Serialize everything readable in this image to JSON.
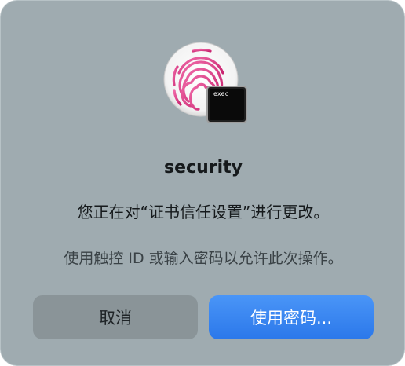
{
  "dialog": {
    "app_icon": "touch-id-fingerprint-with-terminal-icon",
    "terminal_badge_text": "exec",
    "app_name": "security",
    "message": "您正在对“证书信任设置”进行更改。",
    "hint": "使用触控 ID 或输入密码以允许此次操作。",
    "cancel_label": "取消",
    "use_password_label": "使用密码..."
  },
  "colors": {
    "dialog_background": "#9fabb0",
    "primary_button": "#2b78ea",
    "cancel_button": "#8a9498",
    "fingerprint": "#e0448f"
  }
}
